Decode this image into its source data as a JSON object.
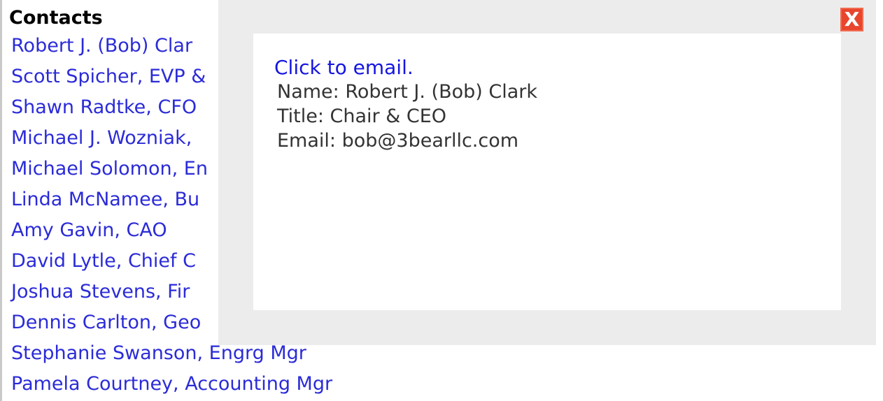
{
  "contacts": {
    "title": "Contacts",
    "items": [
      {
        "label": "Robert J. (Bob) Clar"
      },
      {
        "label": "Scott Spicher, EVP &"
      },
      {
        "label": "Shawn Radtke, CFO"
      },
      {
        "label": "Michael J. Wozniak,"
      },
      {
        "label": "Michael Solomon, En"
      },
      {
        "label": "Linda McNamee, Bu"
      },
      {
        "label": "Amy Gavin, CAO"
      },
      {
        "label": "David Lytle, Chief C"
      },
      {
        "label": "Joshua Stevens, Fir"
      },
      {
        "label": "Dennis Carlton, Geo"
      },
      {
        "label": "Stephanie Swanson, Engrg Mgr"
      },
      {
        "label": "Pamela Courtney, Accounting Mgr"
      }
    ]
  },
  "popup": {
    "close_label": "X",
    "email_link": "Click to email.",
    "name_line": "Name: Robert J. (Bob) Clark",
    "title_line": "Title: Chair & CEO",
    "email_line": "Email: bob@3bearllc.com"
  },
  "colors": {
    "link_blue": "#2b2bd8",
    "close_red": "#e8452d",
    "overlay_gray": "#ececec"
  }
}
